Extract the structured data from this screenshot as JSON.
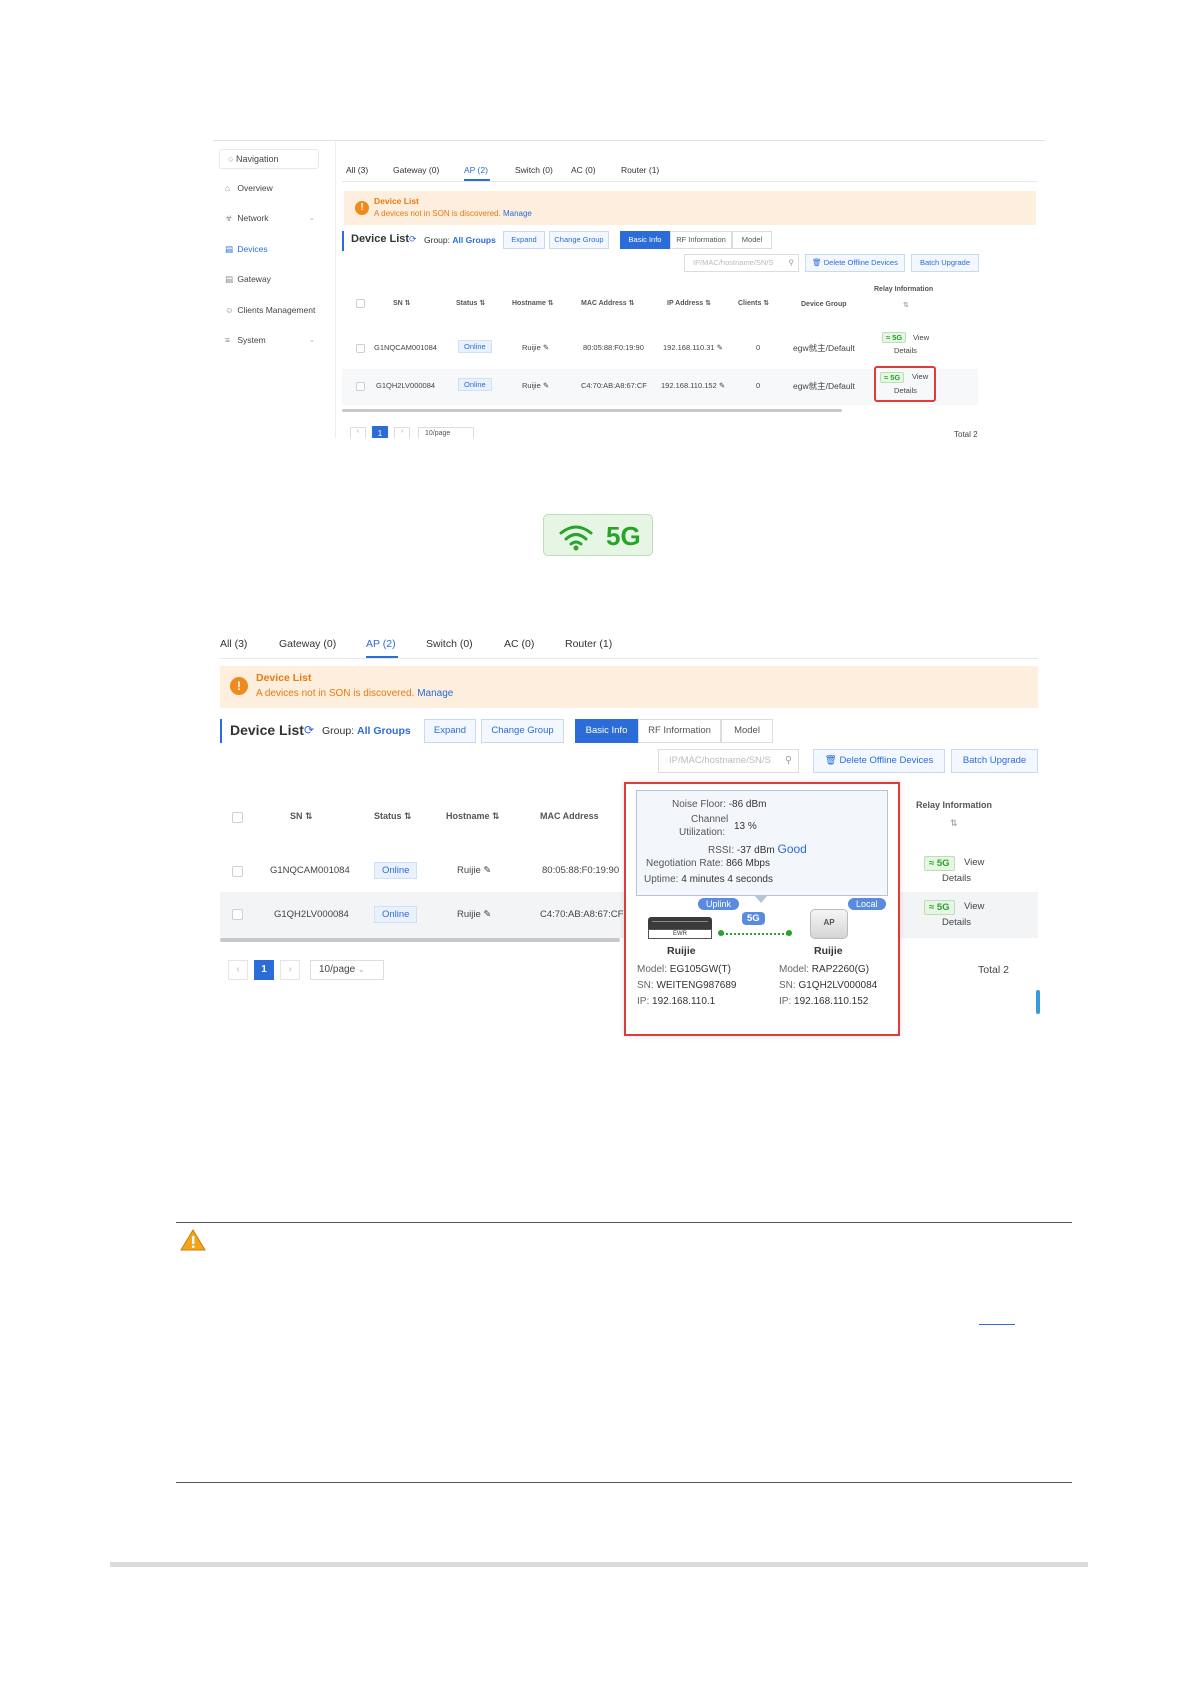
{
  "shot1": {
    "sidebar": {
      "navigation": "Navigation",
      "items": [
        "Overview",
        "Network",
        "Devices",
        "Gateway",
        "Clients Management",
        "System"
      ]
    },
    "tabs": [
      "All (3)",
      "Gateway (0)",
      "AP (2)",
      "Switch (0)",
      "AC (0)",
      "Router (1)"
    ],
    "alert": {
      "title": "Device List",
      "text": "A devices not in SON is discovered.",
      "link": "Manage"
    },
    "toolbar": {
      "title": "Device List",
      "group_label": "Group:",
      "group_value": "All Groups",
      "expand": "Expand",
      "change_group": "Change Group",
      "basic_info": "Basic Info",
      "rf_information": "RF Information",
      "model": "Model",
      "search_placeholder": "IP/MAC/hostname/SN/S",
      "delete_offline": "Delete Offline Devices",
      "batch_upgrade": "Batch Upgrade"
    },
    "columns": [
      "SN",
      "Status",
      "Hostname",
      "MAC Address",
      "IP Address",
      "Clients",
      "Device Group",
      "Relay Information"
    ],
    "rows": [
      {
        "sn": "G1NQCAM001084",
        "status": "Online",
        "hostname": "Ruijie",
        "mac": "80:05:88:F0:19:90",
        "ip": "192.168.110.31",
        "clients": "0",
        "group": "egw就主/Default",
        "band": "5G",
        "view": "View",
        "details": "Details"
      },
      {
        "sn": "G1QH2LV000084",
        "status": "Online",
        "hostname": "Ruijie",
        "mac": "C4:70:AB:A8:67:CF",
        "ip": "192.168.110.152",
        "clients": "0",
        "group": "egw就主/Default",
        "band": "5G",
        "view": "View",
        "details": "Details"
      }
    ],
    "pagination": {
      "page": "1",
      "per_page": "10/page",
      "total": "Total 2"
    }
  },
  "badge": {
    "label": "5G",
    "color": "#27a52b"
  },
  "shot2": {
    "tabs": [
      "All (3)",
      "Gateway (0)",
      "AP (2)",
      "Switch (0)",
      "AC (0)",
      "Router (1)"
    ],
    "alert": {
      "title": "Device List",
      "text": "A devices not in SON is discovered.",
      "link": "Manage"
    },
    "toolbar": {
      "title": "Device List",
      "group_label": "Group:",
      "group_value": "All Groups",
      "expand": "Expand",
      "change_group": "Change Group",
      "basic_info": "Basic Info",
      "rf_information": "RF Information",
      "model": "Model",
      "search_placeholder": "IP/MAC/hostname/SN/S",
      "delete_offline": "Delete Offline Devices",
      "batch_upgrade": "Batch Upgrade"
    },
    "columns": [
      "SN",
      "Status",
      "Hostname",
      "MAC Address",
      "Relay Information"
    ],
    "rows": [
      {
        "sn": "G1NQCAM001084",
        "status": "Online",
        "hostname": "Ruijie",
        "mac": "80:05:88:F0:19:90",
        "band": "5G",
        "view": "View",
        "details": "Details"
      },
      {
        "sn": "G1QH2LV000084",
        "status": "Online",
        "hostname": "Ruijie",
        "mac": "C4:70:AB:A8:67:CF",
        "band": "5G",
        "view": "View",
        "details": "Details"
      }
    ],
    "popover": {
      "noise_floor_label": "Noise Floor:",
      "noise_floor_value": "-86 dBm",
      "channel_label_1": "Channel",
      "channel_label_2": "Utilization:",
      "channel_value": "13 %",
      "rssi_label": "RSSI:",
      "rssi_value": "-37 dBm",
      "rssi_quality": "Good",
      "negotiation_label": "Negotiation Rate:",
      "negotiation_value": "866 Mbps",
      "uptime_label": "Uptime:",
      "uptime_value": "4 minutes 4 seconds",
      "uplink_tag": "Uplink",
      "local_tag": "Local",
      "link_band": "5G",
      "left_device": {
        "box_label": "EWR",
        "name": "Ruijie",
        "model_label": "Model:",
        "model": "EG105GW(T)",
        "sn_label": "SN:",
        "sn": "WEITENG987689",
        "ip_label": "IP:",
        "ip": "192.168.110.1"
      },
      "right_device": {
        "box_label": "AP",
        "name": "Ruijie",
        "model_label": "Model:",
        "model": "RAP2260(G)",
        "sn_label": "SN:",
        "sn": "G1QH2LV000084",
        "ip_label": "IP:",
        "ip": "192.168.110.152"
      }
    },
    "pagination": {
      "page": "1",
      "per_page": "10/page",
      "total": "Total 2"
    }
  },
  "colors": {
    "accent": "#2b6cd8",
    "warning": "#f08a1c",
    "highlight": "#e03b3b",
    "success": "#27a52b"
  }
}
